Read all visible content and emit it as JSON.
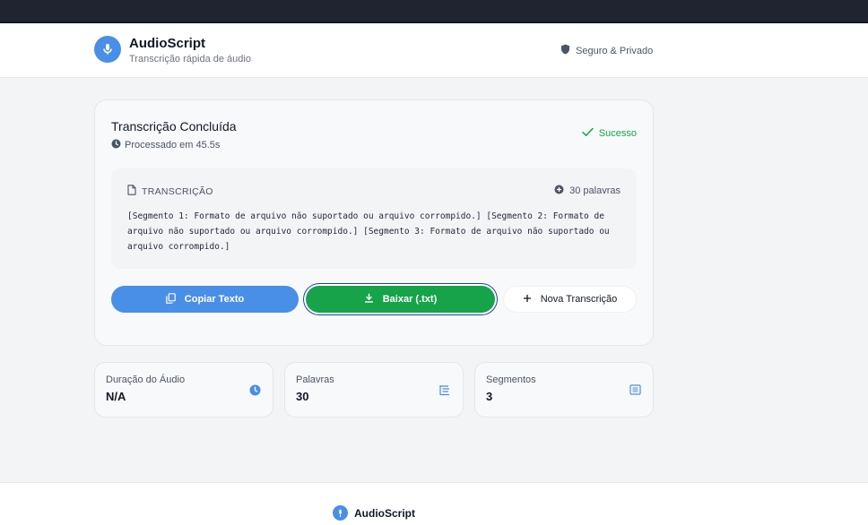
{
  "colors": {
    "accent": "#4a8fe7",
    "success": "#16a34a",
    "topbar": "#1f2430"
  },
  "header": {
    "brand_title": "AudioScript",
    "brand_subtitle": "Transcrição rápida de áudio",
    "secure_label": "Seguro & Privado",
    "logo_icon": "microphone-icon",
    "secure_icon": "shield-icon"
  },
  "result": {
    "title": "Transcrição Concluída",
    "processed": "Processado em 45.5s",
    "status": "Sucesso",
    "transcript_label": "TRANSCRIÇÃO",
    "word_count": "30 palavras",
    "transcript_text": "[Segmento 1: Formato de arquivo não suportado ou arquivo corrompido.] [Segmento 2: Formato de arquivo não suportado ou arquivo corrompido.] [Segmento 3: Formato de arquivo não suportado ou arquivo corrompido.]"
  },
  "actions": {
    "copy_label": "Copiar Texto",
    "download_label": "Baixar (.txt)",
    "new_label": "Nova Transcrição"
  },
  "stats": [
    {
      "label": "Duração do Áudio",
      "value": "N/A",
      "icon": "clock-icon"
    },
    {
      "label": "Palavras",
      "value": "30",
      "icon": "word-list-icon"
    },
    {
      "label": "Segmentos",
      "value": "3",
      "icon": "segments-icon"
    }
  ],
  "footer": {
    "brand": "AudioScript"
  }
}
